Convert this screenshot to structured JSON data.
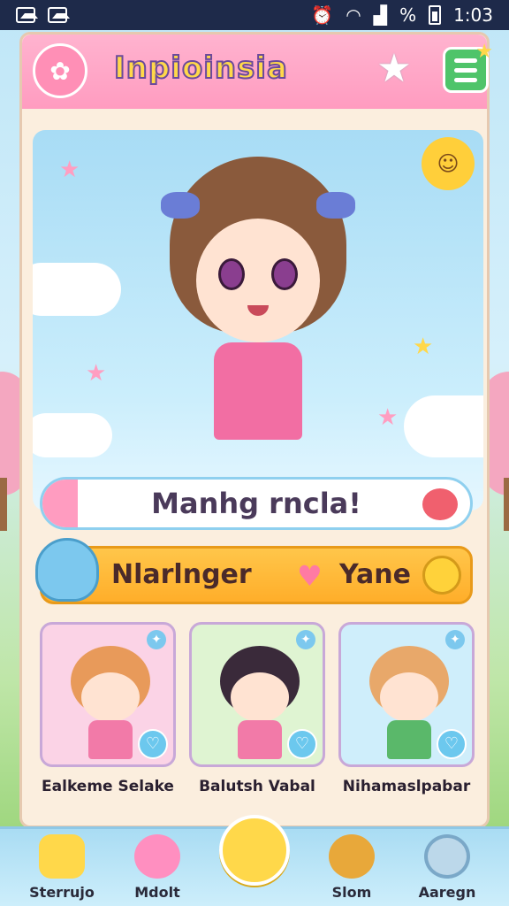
{
  "status_bar": {
    "battery_text": "%",
    "time": "1:03"
  },
  "header": {
    "app_title": "Inpioinsia"
  },
  "hero": {
    "greeting": "Manhg rncla!"
  },
  "name_bar": {
    "name_left": "Nlarlnger",
    "name_right": "Yane"
  },
  "characters": [
    {
      "name": "Ealkeme Selake",
      "hair_color": "#e89a5a",
      "outfit_color": "#f27aa8"
    },
    {
      "name": "Balutsh Vabal",
      "hair_color": "#3a2a3a",
      "outfit_color": "#f27aa8"
    },
    {
      "name": "Nihamaslpabar",
      "hair_color": "#e8a86a",
      "outfit_color": "#5ab86a"
    }
  ],
  "bottom_nav": {
    "items": [
      {
        "label": "Sterrujo",
        "icon": "gift-box-icon",
        "color": "#ffd84a"
      },
      {
        "label": "Mdolt",
        "icon": "pink-pet-icon",
        "color": "#ff8fc0"
      },
      {
        "label": "",
        "icon": "bear-home-icon",
        "color": "#ffd84a"
      },
      {
        "label": "Slom",
        "icon": "bear-icon",
        "color": "#e8a83a"
      },
      {
        "label": "Aaregn",
        "icon": "search-icon",
        "color": "#bcd8ea"
      }
    ]
  },
  "colors": {
    "accent_pink": "#ff9cc0",
    "accent_green": "#4fc46a",
    "accent_yellow": "#ffd84a"
  }
}
